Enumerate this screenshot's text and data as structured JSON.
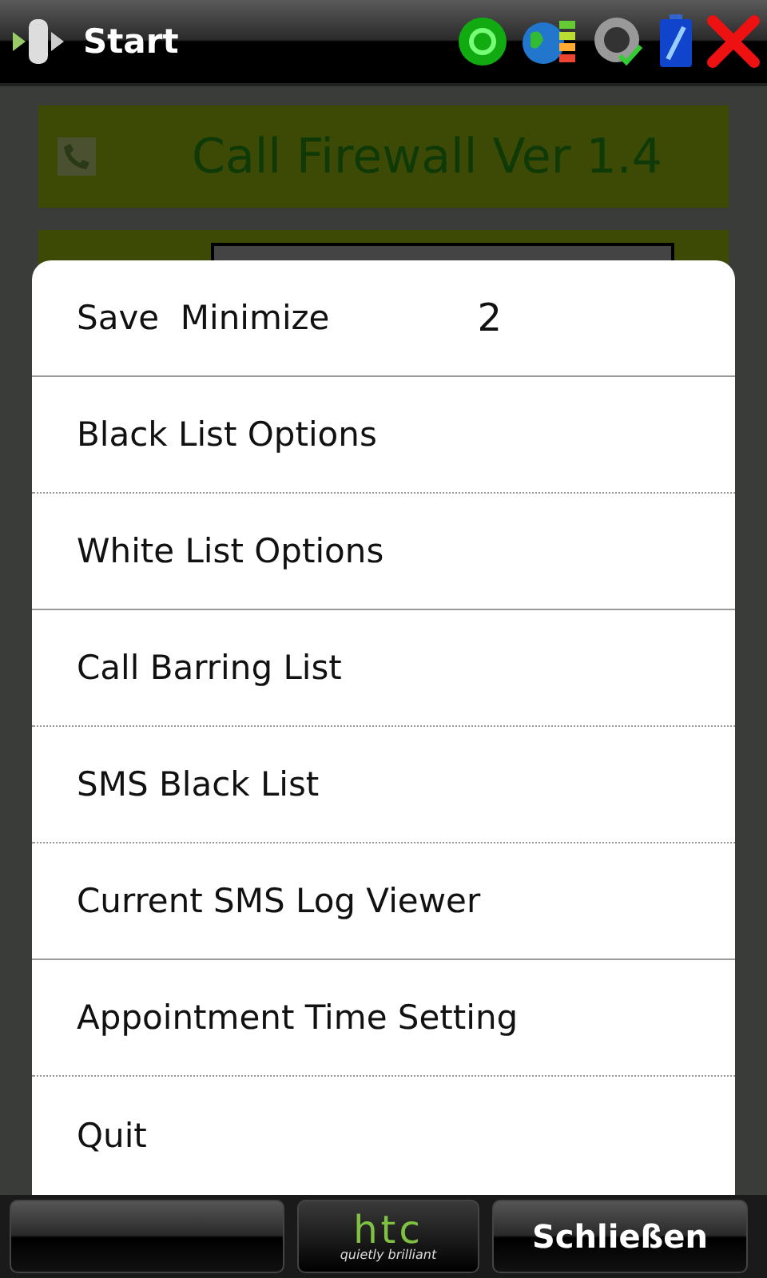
{
  "top_bar": {
    "title": "Start"
  },
  "app": {
    "title": "Call Firewall Ver 1.4"
  },
  "menu": {
    "items": [
      {
        "label": "Save  Minimize",
        "badge": "2",
        "kind": "solid"
      },
      {
        "label": "Black List Options",
        "kind": "dotted"
      },
      {
        "label": "White List Options",
        "kind": "solid"
      },
      {
        "label": "Call Barring List",
        "kind": "dotted"
      },
      {
        "label": "SMS Black List",
        "kind": "dotted"
      },
      {
        "label": "Current SMS Log Viewer",
        "kind": "solid"
      },
      {
        "label": "Appointment Time Setting",
        "kind": "dotted"
      },
      {
        "label": "Quit",
        "kind": "plain"
      }
    ]
  },
  "bottom_bar": {
    "logo": "htc",
    "slogan": "quietly brilliant",
    "right_button": "Schließen"
  }
}
